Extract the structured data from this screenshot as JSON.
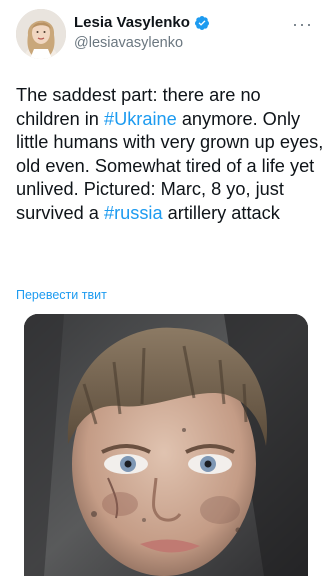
{
  "author": {
    "name": "Lesia Vasylenko",
    "handle": "@lesiavasylenko",
    "verified": true
  },
  "tweet": {
    "text_part1": "The saddest part: there are no children in ",
    "hashtag1": "#Ukraine",
    "text_part2": " anymore. Only little humans with very grown up eyes, old even. Somewhat tired of a life yet unlived. Pictured: Marc, 8 yo, just survived a ",
    "hashtag2": "#russia",
    "text_part3": " artillery attack"
  },
  "translate_label": "Перевести твит",
  "more_label": "···",
  "colors": {
    "link": "#1d9bf0",
    "verified_badge": "#1d9bf0",
    "text": "#0f1419",
    "secondary": "#6b7780"
  },
  "icons": {
    "verified": "verified-badge-icon",
    "more": "more-options-icon"
  }
}
